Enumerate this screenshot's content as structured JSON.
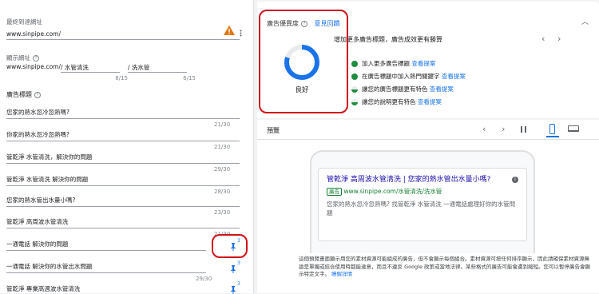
{
  "left": {
    "final_url_label": "最終到達網址",
    "final_url_value": "www.sinpipe.com/",
    "display_path_label": "顯示網址",
    "display_path_domain": "www.sinpipe.com/",
    "path1_value": "水管清洗",
    "path2_value": "洗水管",
    "path1_count": "8/15",
    "path2_count": "6/15",
    "headlines_label": "廣告標題",
    "headlines": [
      {
        "text": "您家的熱水忽冷忽熱嗎?",
        "count": "21/30"
      },
      {
        "text": "你家的熱水忽冷忽熱嗎?",
        "count": "21/30"
      },
      {
        "text": "管乾淨 水管清洗，解決你的問題",
        "count": "29/30"
      },
      {
        "text": "管乾淨 水管清洗 解決你的問題",
        "count": "28/30"
      },
      {
        "text": "您家的熱水管出水量小嗎?",
        "count": "23/30"
      },
      {
        "text": "管乾淨 高周波水管清洗",
        "count": "21/30"
      },
      {
        "text": "一通電話 解決你的問題",
        "count": "",
        "pin": "3"
      },
      {
        "text": "一通電話 解決你的水管出水問題",
        "count": "29/30",
        "pin": "3"
      },
      {
        "text": "管乾淨 專業高週波水管清洗",
        "count": "",
        "pin": "3"
      }
    ]
  },
  "quality": {
    "title": "廣告優異度",
    "feedback_link": "意見回饋",
    "rating": "良好",
    "suggestion_heading": "增加更多廣告標題，廣告成效更有勝算",
    "checks": [
      {
        "text": "加入更多廣告標題",
        "link": "查看提案",
        "status": "done"
      },
      {
        "text": "在廣告標題中加入熱門關鍵字",
        "link": "查看提案",
        "status": "done"
      },
      {
        "text": "讓您的廣告標題更有特色",
        "link": "查看提案",
        "status": "partial"
      },
      {
        "text": "讓您的說明更有特色",
        "link": "查看提案",
        "status": "partial"
      }
    ],
    "progress": 0.8,
    "colors": {
      "ring": "#1a73e8",
      "check": "#1e8e3e",
      "warn": "#e37400",
      "highlight": "#d0121a"
    }
  },
  "preview": {
    "title": "預覽",
    "ad_headline": "管乾淨 高周波水管清洗 | 您家的熱水管出水量小嗎?",
    "ad_badge": "廣告",
    "ad_url": "www.sinpipe.com/水管清洗/洗水管",
    "ad_description": "您家的熱水忽冷忽熱嗎? 找管乾淨 水管清洗 一通電話處理好你的水管問題",
    "disclaimer": "這個預覽畫面顯示用您的素材資源可能組成的廣告，但不會顯示每個組合。素材資源可按任何排序顯示，因此請確保素材資源無論是單獨或結合使用時都能達意，而且不違反 Google 政策或當地法律。某些格式的廣告可能會遭到縮短。您可以暫停廣告會顯示特定文字。",
    "learn_more": "瞭解詳情"
  }
}
